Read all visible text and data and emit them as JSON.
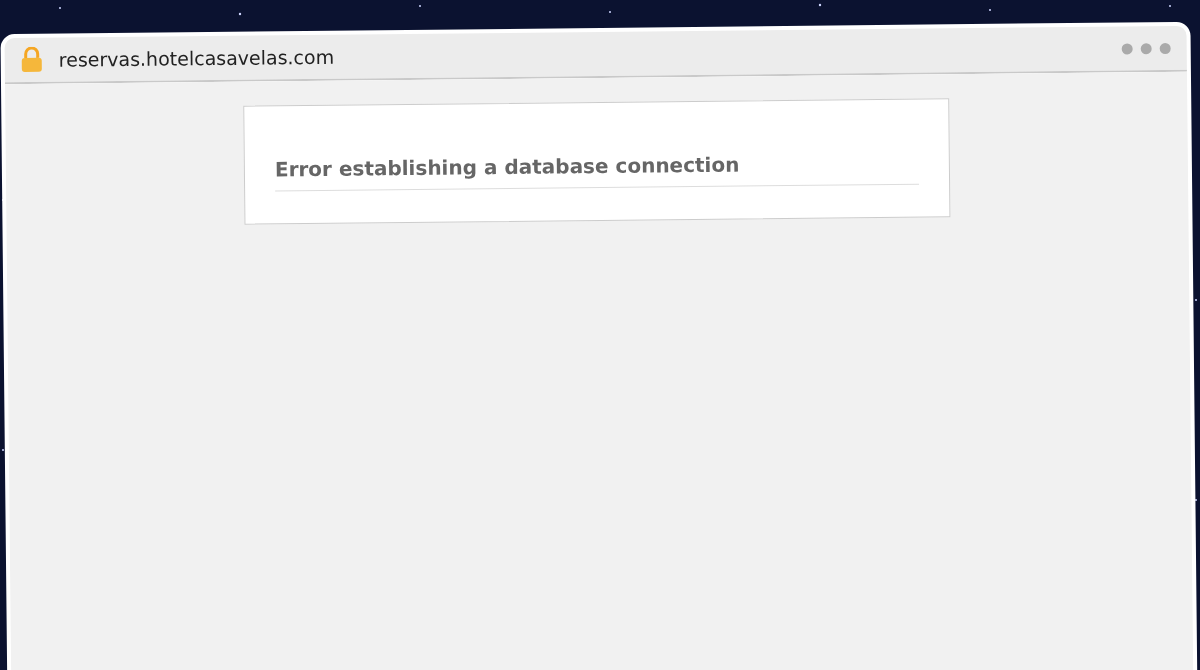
{
  "browser": {
    "url": "reservas.hotelcasavelas.com"
  },
  "page": {
    "error_message": "Error establishing a database connection"
  }
}
